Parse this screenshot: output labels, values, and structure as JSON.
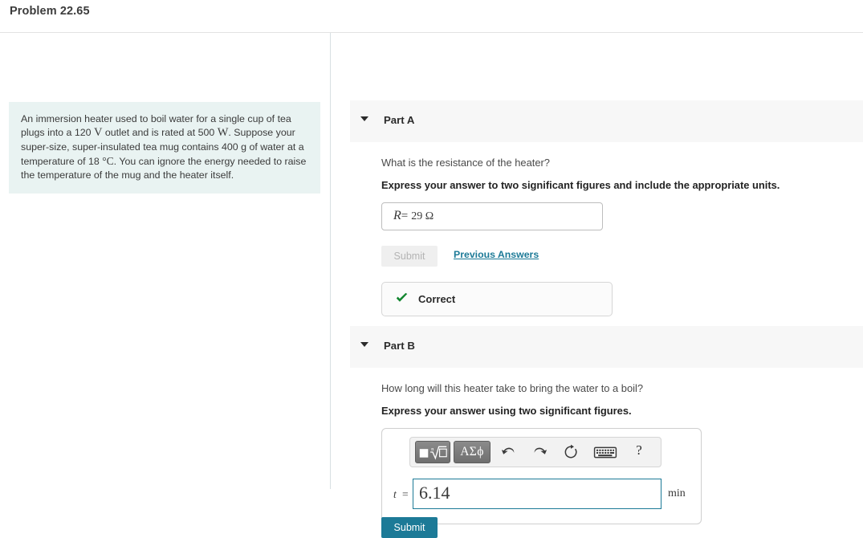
{
  "header": {
    "title": "Problem 22.65"
  },
  "problem": {
    "text_segments": [
      "An immersion heater used to boil water for a single cup of tea plugs into a 120 ",
      "V",
      " outlet and is rated at 500 ",
      "W",
      ". Suppose your super-size, super-insulated tea mug contains 400 g of water at a temperature of 18 ",
      "°C",
      ". You can ignore the energy needed to raise the temperature of the mug and the heater itself."
    ]
  },
  "parts": {
    "a": {
      "caret_icon": "caret-down-icon",
      "label": "Part A",
      "question": "What is the resistance of the heater?",
      "instruction": "Express your answer to two significant figures and include the appropriate units.",
      "answer": {
        "variable": "R",
        "equals": "=",
        "value": "29 Ω"
      },
      "submit_label": "Submit",
      "previous_answers_label": "Previous Answers",
      "feedback": {
        "icon": "check-icon",
        "label": "Correct",
        "color": "#12862f"
      }
    },
    "b": {
      "caret_icon": "caret-down-icon",
      "label": "Part B",
      "question": "How long will this heater take to bring the water to a boil?",
      "instruction": "Express your answer using two significant figures.",
      "toolbar": {
        "template_button": "math-template-icon",
        "greek_button": "ΑΣϕ",
        "undo": "undo-icon",
        "redo": "redo-icon",
        "reset": "reset-icon",
        "keyboard": "keyboard-icon",
        "help": "?"
      },
      "answer": {
        "variable": "t",
        "equals": "=",
        "value": "6.14",
        "placeholder": "",
        "unit": "min"
      },
      "submit_label": "Submit"
    }
  },
  "colors": {
    "accent_teal": "#1c7a97",
    "success_green": "#12862f",
    "panel_grey": "#f7f7f7",
    "problem_bg": "#e9f3f2"
  }
}
